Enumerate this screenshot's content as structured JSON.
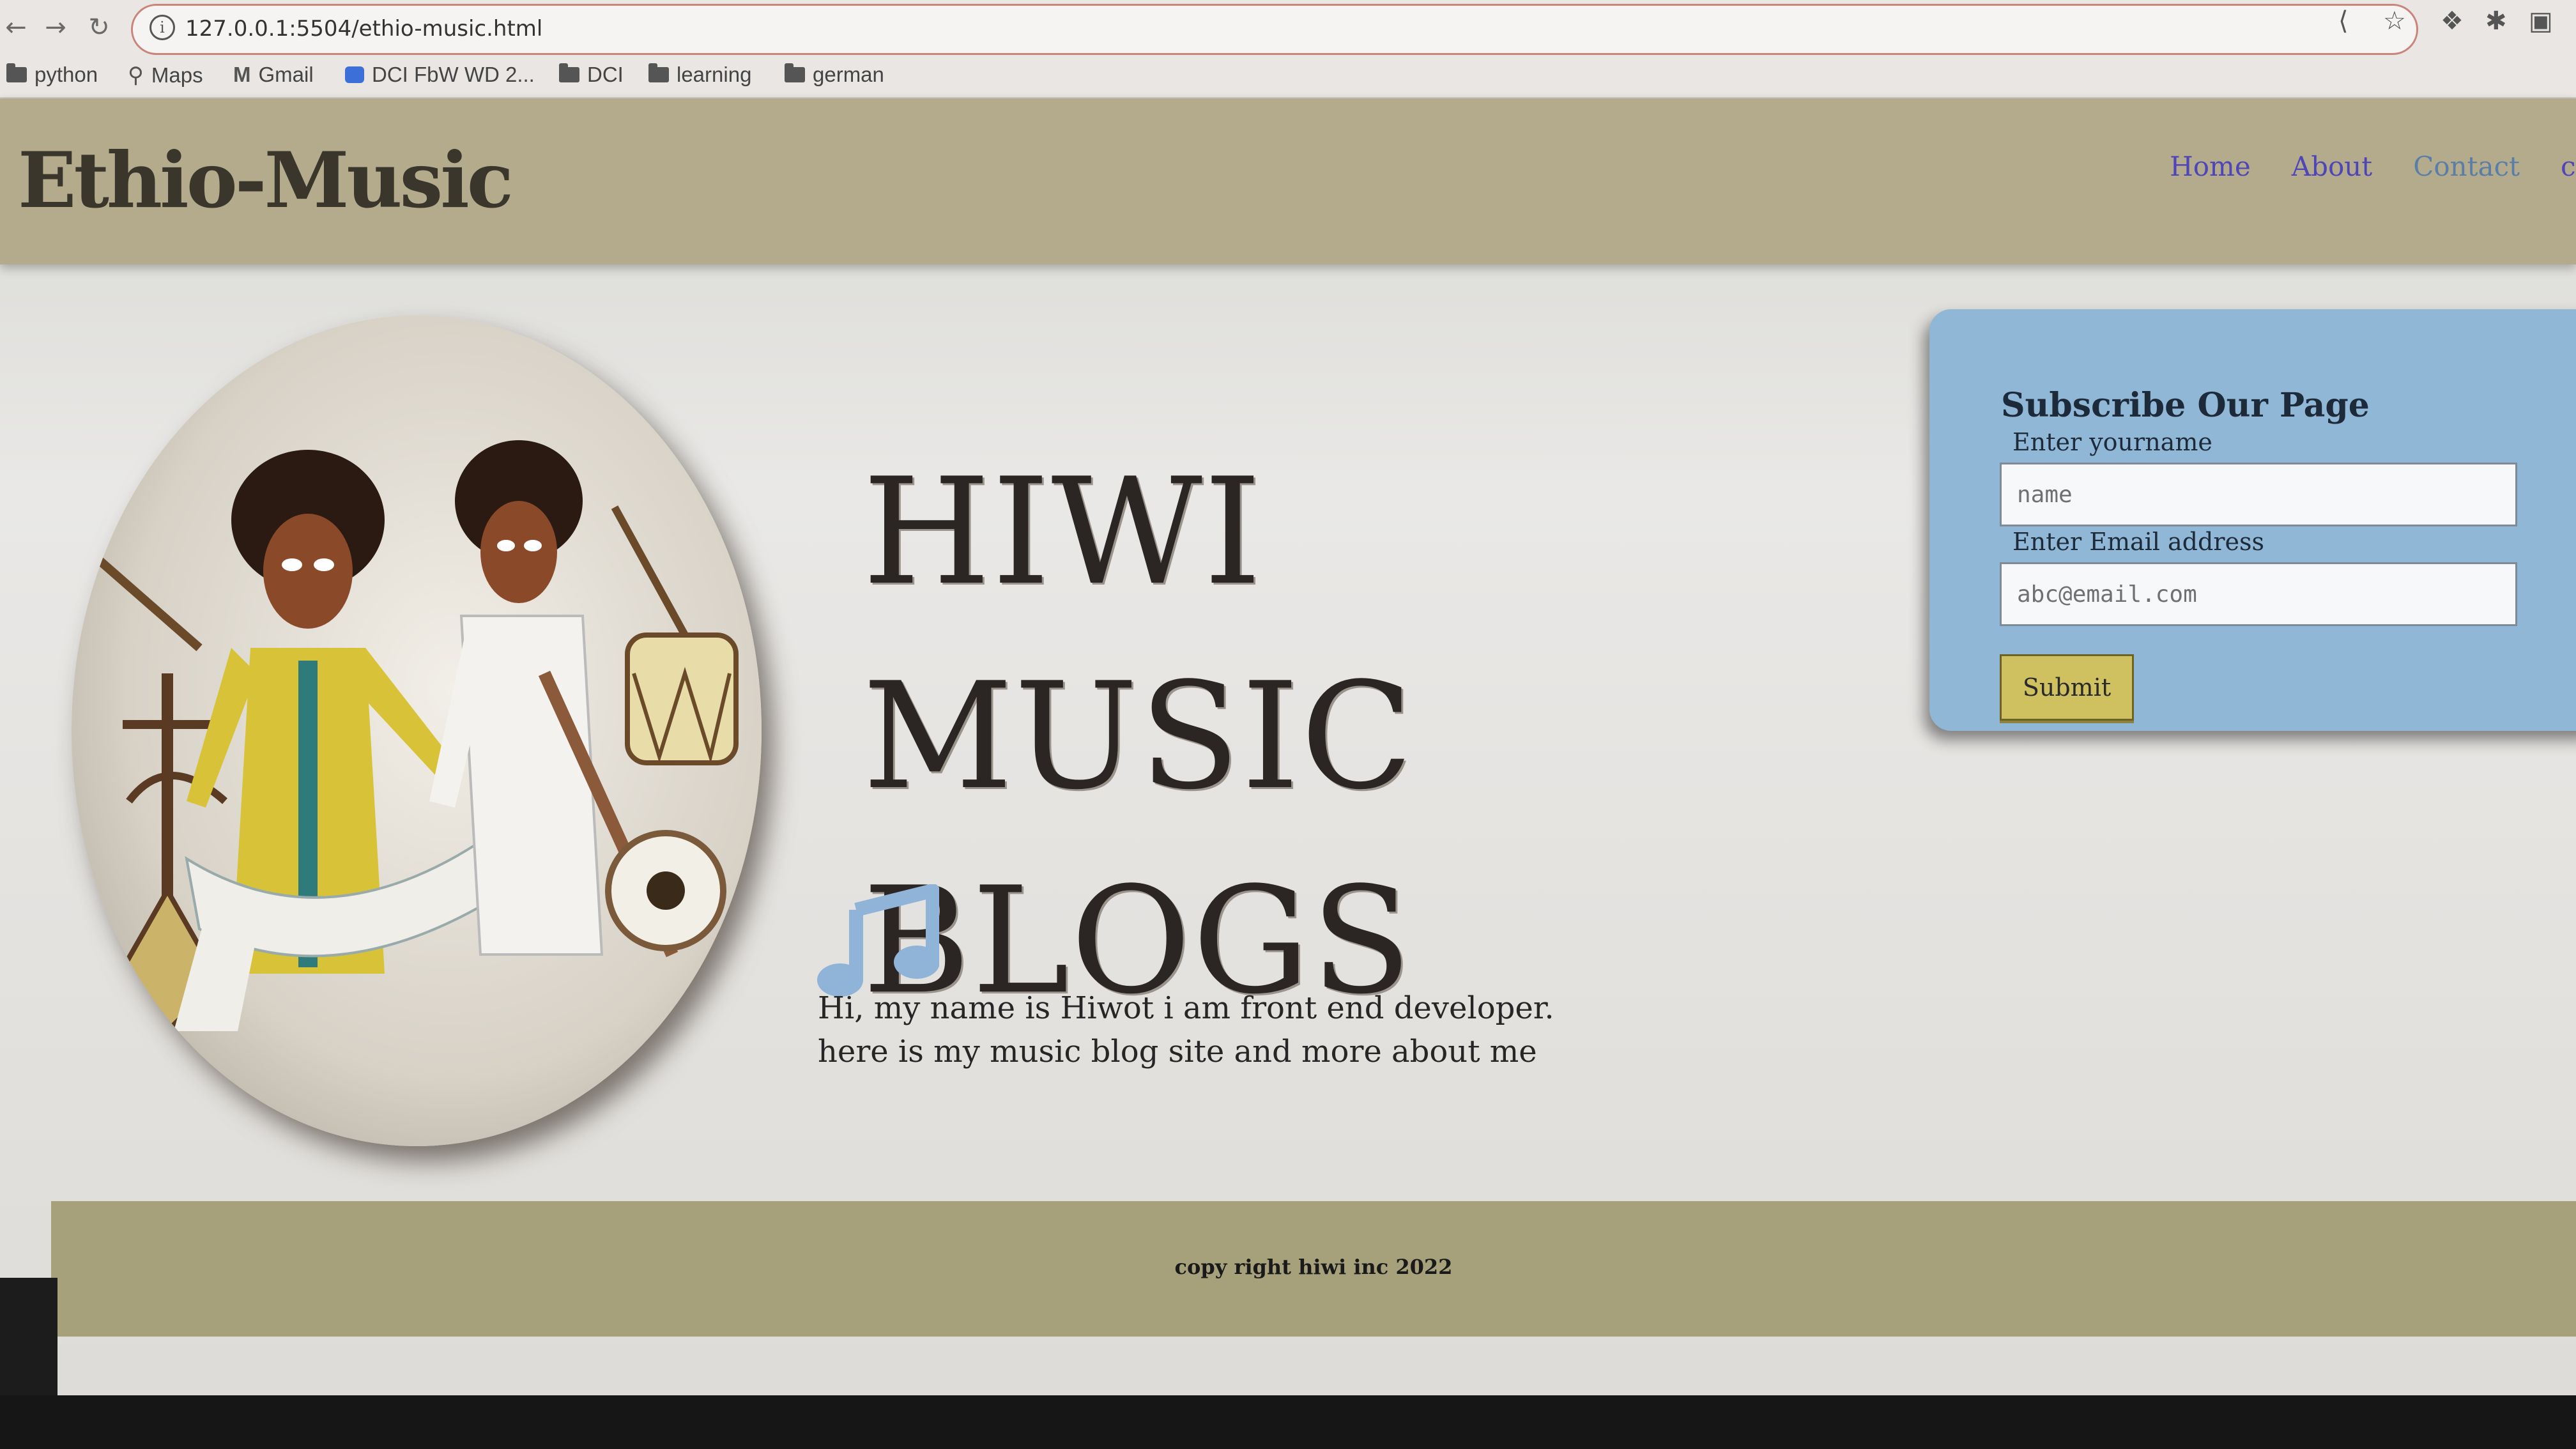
{
  "browser": {
    "url": "127.0.0.1:5504/ethio-music.html",
    "bookmarks": [
      {
        "label": "python",
        "icon": "folder-icon"
      },
      {
        "label": "Maps",
        "icon": "map-pin-icon"
      },
      {
        "label": "Gmail",
        "icon": "gmail-icon"
      },
      {
        "label": "DCI FbW WD 2...",
        "icon": "meet-icon"
      },
      {
        "label": "DCI",
        "icon": "folder-icon"
      },
      {
        "label": "learning",
        "icon": "folder-icon"
      },
      {
        "label": "german",
        "icon": "folder-icon"
      }
    ]
  },
  "header": {
    "logo": "Ethio-Music",
    "nav": [
      "Home",
      "About",
      "Contact",
      "cul"
    ]
  },
  "hero": {
    "title_line1": "HIWI MUSIC",
    "title_line2": "BLOGS",
    "intro_line1": "Hi, my name is Hiwot i am front end developer.",
    "intro_line2": "here is my music blog site and more about me"
  },
  "subscribe": {
    "title": "Subscribe Our Page",
    "name_label": "Enter yourname",
    "name_placeholder": "name",
    "email_label": "Enter Email address",
    "email_placeholder": "abc@email.com",
    "submit_label": "Submit"
  },
  "footer": {
    "copyright": "copy right hiwi inc 2022"
  },
  "colors": {
    "header_bg": "#b3ab8c",
    "nav_link": "#4e45b8",
    "card_bg": "#90b7d6",
    "submit_bg": "#cfc160",
    "footer_bg": "#a6a07b"
  }
}
